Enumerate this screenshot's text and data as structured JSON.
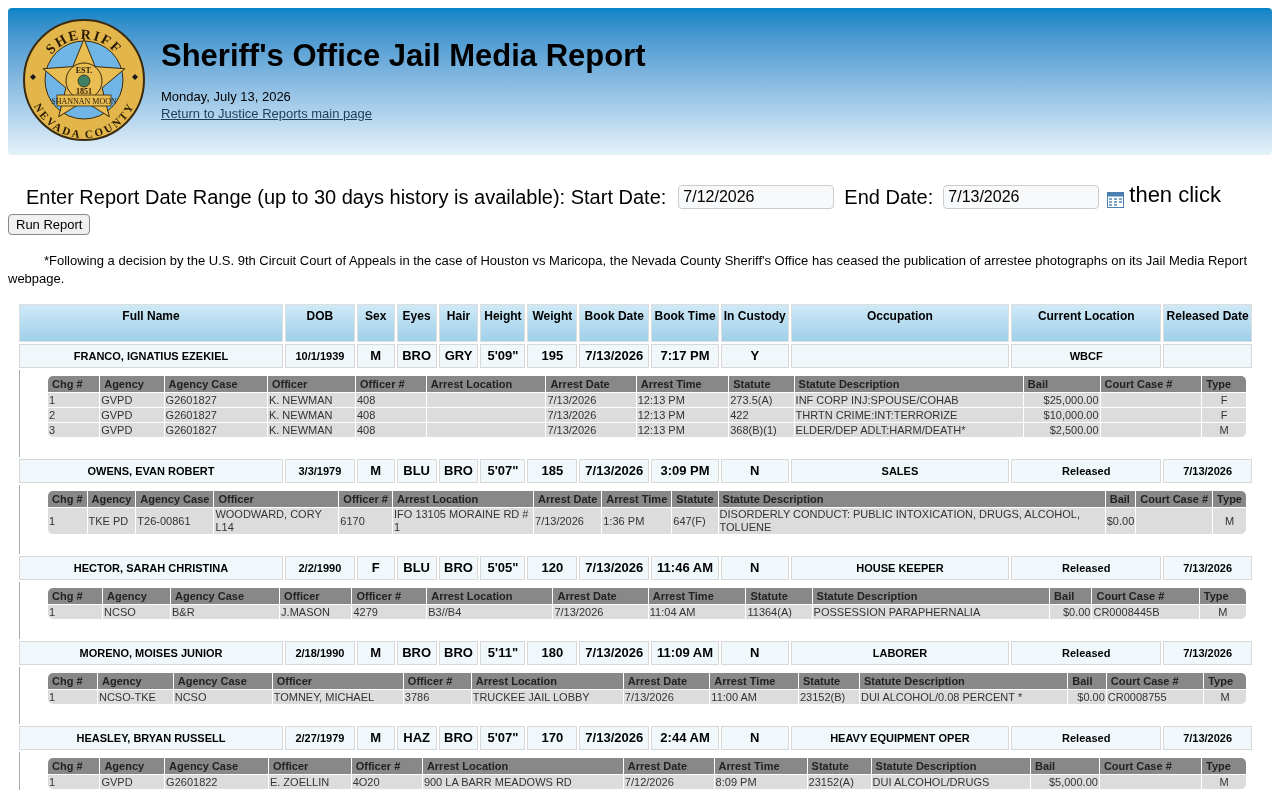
{
  "logo": {
    "top": "SHERIFF",
    "est": "EST.",
    "year": "1851",
    "banner": "SHANNAN MOON",
    "bottom": "NEVADA COUNTY"
  },
  "header": {
    "title": "Sheriff's Office Jail Media Report",
    "date": "Monday, July 13, 2026",
    "link": "Return to Justice Reports main page"
  },
  "date_range": {
    "label": "Enter Report Date Range (up to 30 days history is available): Start Date:",
    "start": "7/12/2026",
    "end_label": "End Date:",
    "end": "7/13/2026",
    "then": "then click",
    "button": "Run Report"
  },
  "notice": "*Following a decision by the U.S. 9th Circuit Court of Appeals in the case of Houston vs Maricopa, the Nevada County Sheriff's Office has ceased the publication of arrestee photographs on its Jail Media Report webpage.",
  "columns": [
    "Full Name",
    "DOB",
    "Sex",
    "Eyes",
    "Hair",
    "Height",
    "Weight",
    "Book Date",
    "Book Time",
    "In Custody",
    "Occupation",
    "Current Location",
    "Released Date"
  ],
  "inmates": [
    {
      "name": "FRANCO, IGNATIUS EZEKIEL",
      "dob": "10/1/1939",
      "sex": "M",
      "eyes": "BRO",
      "hair": "GRY",
      "height": "5'09\"",
      "weight": "195",
      "book_date": "7/13/2026",
      "book_time": "7:17 PM",
      "in_custody": "Y",
      "location": "WBCF",
      "charge_columns": [
        "Chg #",
        "Agency",
        "Agency Case",
        "Officer",
        "Officer #",
        "Arrest Location",
        "Arrest Date",
        "Arrest Time",
        "Statute",
        "Statute Description",
        "Bail",
        "Court Case #",
        "Type"
      ],
      "charges": [
        {
          "chg": "1",
          "agency": "GVPD",
          "agency_case": "G2601827",
          "officer": "K. NEWMAN",
          "officer_no": "408",
          "arrest_date": "7/13/2026",
          "arrest_time": "12:13 PM",
          "statute": "273.5(A)",
          "description": "INF CORP INJ:SPOUSE/COHAB",
          "bail": "$25,000.00",
          "type": "F"
        },
        {
          "chg": "2",
          "agency": "GVPD",
          "agency_case": "G2601827",
          "officer": "K. NEWMAN",
          "officer_no": "408",
          "arrest_date": "7/13/2026",
          "arrest_time": "12:13 PM",
          "statute": "422",
          "description": "THRTN CRIME:INT:TERRORIZE",
          "bail": "$10,000.00",
          "type": "F"
        },
        {
          "chg": "3",
          "agency": "GVPD",
          "agency_case": "G2601827",
          "officer": "K. NEWMAN",
          "officer_no": "408",
          "arrest_date": "7/13/2026",
          "arrest_time": "12:13 PM",
          "statute": "368(B)(1)",
          "description": "ELDER/DEP ADLT:HARM/DEATH*",
          "bail": "$2,500.00",
          "type": "M"
        }
      ]
    },
    {
      "name": "OWENS, EVAN ROBERT",
      "dob": "3/3/1979",
      "sex": "M",
      "eyes": "BLU",
      "hair": "BRO",
      "height": "5'07\"",
      "weight": "185",
      "book_date": "7/13/2026",
      "book_time": "3:09 PM",
      "in_custody": "N",
      "occupation": "SALES",
      "location": "Released",
      "released": "7/13/2026",
      "charge_columns": [
        "Chg #",
        "Agency",
        "Agency Case",
        "Officer",
        "Officer #",
        "Arrest Location",
        "Arrest Date",
        "Arrest Time",
        "Statute",
        "Statute Description",
        "Bail",
        "Court Case #",
        "Type"
      ],
      "charges": [
        {
          "chg": "1",
          "agency": "TKE PD",
          "agency_case": "T26-00861",
          "officer": "WOODWARD, CORY L14",
          "officer_no": "6170",
          "arrest_location": "IFO 13105 MORAINE RD # 1",
          "arrest_date": "7/13/2026",
          "arrest_time": "1:36 PM",
          "statute": "647(F)",
          "description": "DISORDERLY CONDUCT: PUBLIC INTOXICATION, DRUGS, ALCOHOL, TOLUENE",
          "bail": "$0.00",
          "type": "M"
        }
      ]
    },
    {
      "name": "HECTOR, SARAH CHRISTINA",
      "dob": "2/2/1990",
      "sex": "F",
      "eyes": "BLU",
      "hair": "BRO",
      "height": "5'05\"",
      "weight": "120",
      "book_date": "7/13/2026",
      "book_time": "11:46 AM",
      "in_custody": "N",
      "occupation": "HOUSE KEEPER",
      "location": "Released",
      "released": "7/13/2026",
      "charge_columns": [
        "Chg #",
        "Agency",
        "Agency Case",
        "Officer",
        "Officer #",
        "Arrest Location",
        "Arrest Date",
        "Arrest Time",
        "Statute",
        "Statute Description",
        "Bail",
        "Court Case #",
        "Type"
      ],
      "charges": [
        {
          "chg": "1",
          "agency": "NCSO",
          "agency_case": "B&R",
          "officer": "J.MASON",
          "officer_no": "4279",
          "arrest_location": "B3//B4",
          "arrest_date": "7/13/2026",
          "arrest_time": "11:04 AM",
          "statute": "11364(A)",
          "description": "POSSESSION PARAPHERNALIA",
          "bail": "$0.00",
          "court_case": "CR0008445B",
          "type": "M"
        }
      ]
    },
    {
      "name": "MORENO, MOISES JUNIOR",
      "dob": "2/18/1990",
      "sex": "M",
      "eyes": "BRO",
      "hair": "BRO",
      "height": "5'11\"",
      "weight": "180",
      "book_date": "7/13/2026",
      "book_time": "11:09 AM",
      "in_custody": "N",
      "occupation": "LABORER",
      "location": "Released",
      "released": "7/13/2026",
      "charge_columns": [
        "Chg #",
        "Agency",
        "Agency Case",
        "Officer",
        "Officer #",
        "Arrest Location",
        "Arrest Date",
        "Arrest Time",
        "Statute",
        "Statute Description",
        "Bail",
        "Court Case #",
        "Type"
      ],
      "charges": [
        {
          "chg": "1",
          "agency": "NCSO-TKE",
          "agency_case": "NCSO",
          "officer": "TOMNEY, MICHAEL",
          "officer_no": "3786",
          "arrest_location": "TRUCKEE JAIL LOBBY",
          "arrest_date": "7/13/2026",
          "arrest_time": "11:00 AM",
          "statute": "23152(B)",
          "description": "DUI ALCOHOL/0.08 PERCENT *",
          "bail": "$0.00",
          "court_case": "CR0008755",
          "type": "M"
        }
      ]
    },
    {
      "name": "HEASLEY, BRYAN RUSSELL",
      "dob": "2/27/1979",
      "sex": "M",
      "eyes": "HAZ",
      "hair": "BRO",
      "height": "5'07\"",
      "weight": "170",
      "book_date": "7/13/2026",
      "book_time": "2:44 AM",
      "in_custody": "N",
      "occupation": "HEAVY EQUIPMENT OPER",
      "location": "Released",
      "released": "7/13/2026",
      "charge_columns": [
        "Chg #",
        "Agency",
        "Agency Case",
        "Officer",
        "Officer #",
        "Arrest Location",
        "Arrest Date",
        "Arrest Time",
        "Statute",
        "Statute Description",
        "Bail",
        "Court Case #",
        "Type"
      ],
      "charges": [
        {
          "chg": "1",
          "agency": "GVPD",
          "agency_case": "G2601822",
          "officer": "E. ZOELLIN",
          "officer_no": "4O20",
          "arrest_location": "900 LA BARR MEADOWS RD",
          "arrest_date": "7/12/2026",
          "arrest_time": "8:09 PM",
          "statute": "23152(A)",
          "description": "DUI ALCOHOL/DRUGS",
          "bail": "$5,000.00",
          "type": "M"
        }
      ]
    }
  ]
}
